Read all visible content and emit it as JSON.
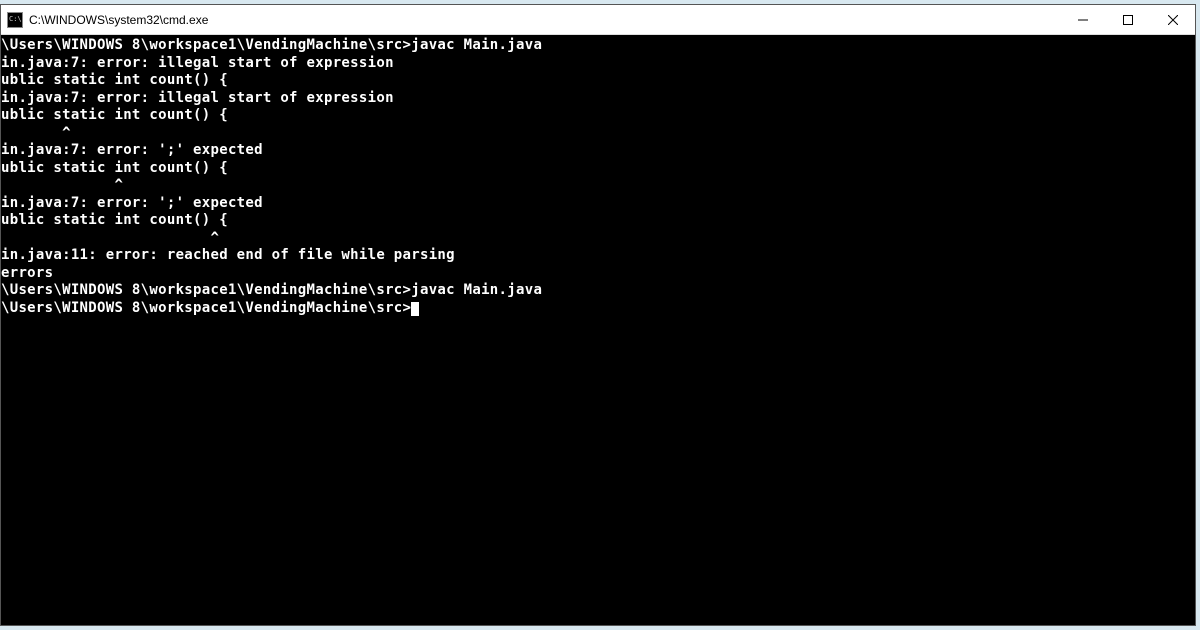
{
  "window": {
    "title": "C:\\WINDOWS\\system32\\cmd.exe"
  },
  "terminal": {
    "lines": [
      "\\Users\\WINDOWS 8\\workspace1\\VendingMachine\\src>javac Main.java",
      "in.java:7: error: illegal start of expression",
      "ublic static int count() {",
      "",
      "in.java:7: error: illegal start of expression",
      "ublic static int count() {",
      "       ^",
      "in.java:7: error: ';' expected",
      "ublic static int count() {",
      "             ^",
      "in.java:7: error: ';' expected",
      "ublic static int count() {",
      "                        ^",
      "in.java:11: error: reached end of file while parsing",
      "",
      "",
      "errors",
      "",
      "\\Users\\WINDOWS 8\\workspace1\\VendingMachine\\src>javac Main.java",
      "",
      "\\Users\\WINDOWS 8\\workspace1\\VendingMachine\\src>"
    ]
  }
}
